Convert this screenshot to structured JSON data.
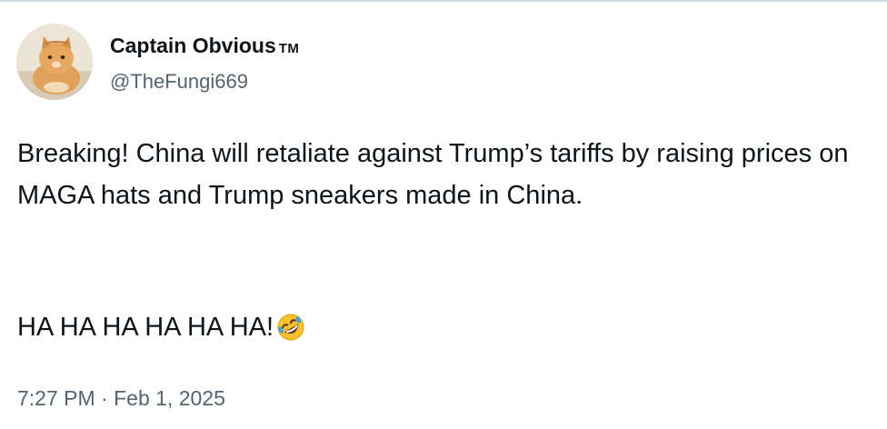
{
  "author": {
    "display_name": "Captain Obvious",
    "trademark": "TM",
    "handle": "@TheFungi669",
    "avatar": "orange-cat-avatar"
  },
  "tweet": {
    "text_line": "Breaking! China will retaliate against Trump’s tariffs by raising prices on MAGA hats and Trump sneakers made in China.",
    "laugh_line": "HA HA HA HA HA HA!",
    "emoji": "rolling-on-floor-laughing-emoji",
    "time": "7:27 PM",
    "separator": "·",
    "date": "Feb 1, 2025"
  },
  "colors": {
    "primary_text": "#0f1419",
    "secondary_text": "#536471",
    "divider": "#cfd9de",
    "emoji_face": "#fbc02d"
  }
}
